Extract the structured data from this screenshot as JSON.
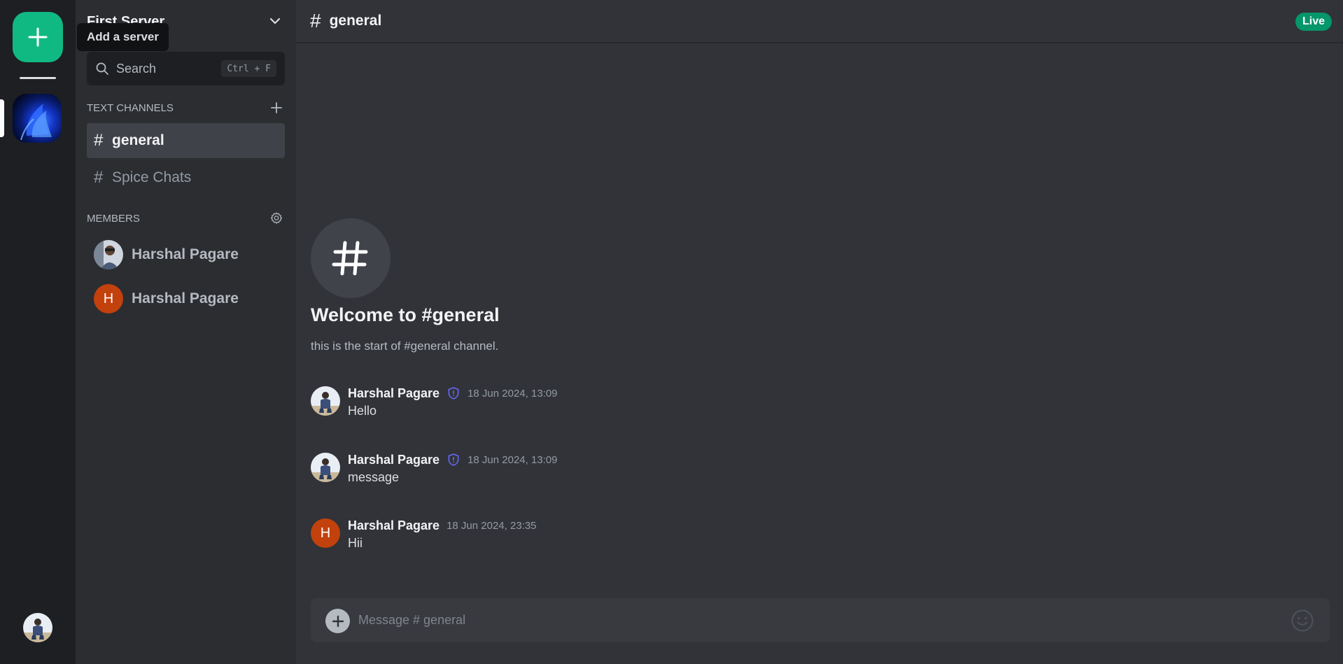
{
  "colors": {
    "brand_green": "#10b981",
    "live_green": "#059669",
    "member_letter_avatar": "#c2410c",
    "moderator_badge": "#6366f1"
  },
  "rail": {
    "add_server_tooltip": "Add a server",
    "add_server_icon": "plus-icon"
  },
  "server": {
    "name": "First Server",
    "chevron_icon": "chevron-down-icon"
  },
  "search": {
    "label": "Search",
    "shortcut": "Ctrl + F"
  },
  "sections": {
    "text_channels": "TEXT CHANNELS",
    "members": "MEMBERS"
  },
  "channels": [
    {
      "name": "general",
      "active": true
    },
    {
      "name": "Spice Chats",
      "active": false
    }
  ],
  "members": [
    {
      "name": "Harshal Pagare",
      "avatar": "photo"
    },
    {
      "name": "Harshal Pagare",
      "avatar": "letter",
      "letter": "H"
    }
  ],
  "topbar": {
    "hash": "#",
    "channel": "general",
    "status": "Live"
  },
  "welcome": {
    "title": "Welcome to #general",
    "subtitle": "this is the start of #general channel."
  },
  "messages": [
    {
      "author": "Harshal Pagare",
      "avatar": "photo",
      "moderator": true,
      "time": "18 Jun 2024, 13:09",
      "text": "Hello"
    },
    {
      "author": "Harshal Pagare",
      "avatar": "photo",
      "moderator": true,
      "time": "18 Jun 2024, 13:09",
      "text": "message"
    },
    {
      "author": "Harshal Pagare",
      "avatar": "letter",
      "letter": "H",
      "moderator": false,
      "time": "18 Jun 2024, 23:35",
      "text": "Hii"
    }
  ],
  "composer": {
    "placeholder": "Message # general"
  }
}
